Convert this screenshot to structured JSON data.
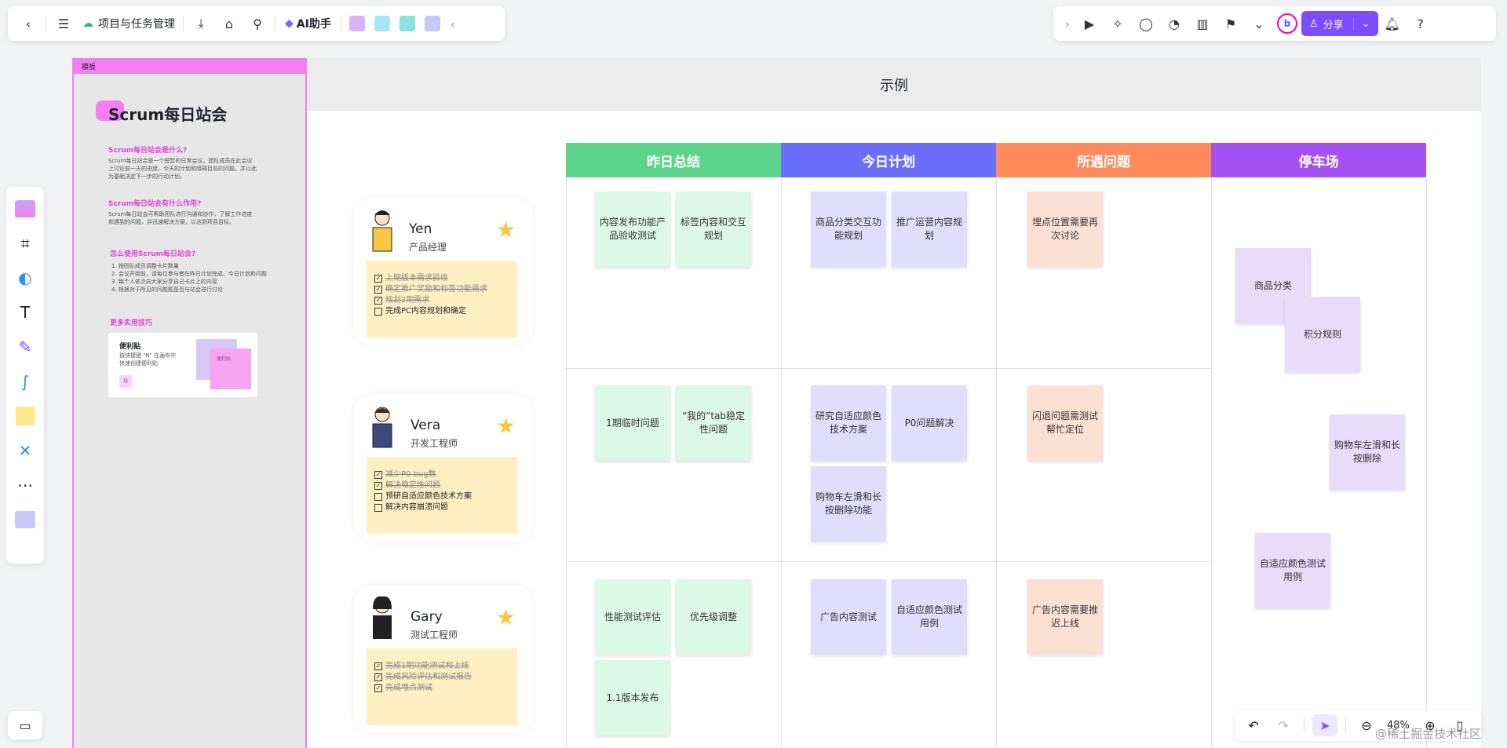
{
  "toolbar": {
    "doc_title": "项目与任务管理",
    "ai_label": "AI助手",
    "share_label": "分享"
  },
  "template": {
    "bar_label": "模板",
    "title": "Scrum每日站会",
    "q1": "Scrum每日站会是什么?",
    "a1": "Scrum每日站会是一个短暂的日常会议，团队成员在此会议上讨论前一天的进度、今天的计划和阻碍目前的问题，并以此为基础决定下一步的行动计划。",
    "q2": "Scrum每日站会有什么作用?",
    "a2": "Scrum每日站会可帮助团队进行沟通和协作，了解工作进度和遇到的问题，并迅速解决方案，以达到项目目标。",
    "q3": "怎么使用Scrum每日站会?",
    "steps": [
      "1. 按团队成员调整卡片数量",
      "2. 会议开始前，请每位参与者在昨日计划完成、今日计划和问题",
      "3. 每个人依次向大家分享自己卡片上的内容",
      "4. 根据对于所见的问题题是否与站会进行讨论"
    ],
    "q4": "更多实用技巧",
    "tip_title": "便利贴",
    "tip_text1": "按快捷键 \"N\" 在画布中",
    "tip_text2": "快速创建便利贴",
    "tip_key": "N",
    "tip_note": "便利贴"
  },
  "board": {
    "title": "示例",
    "columns": [
      {
        "label": "昨日总结",
        "color": "#5cd48b"
      },
      {
        "label": "今日计划",
        "color": "#6b6ef9"
      },
      {
        "label": "所遇问题",
        "color": "#ff8a5c"
      },
      {
        "label": "停车场",
        "color": "#a550f0"
      }
    ],
    "people": [
      {
        "name": "Yen",
        "role": "产品经理",
        "tasks": [
          {
            "text": "上期版本需求验收",
            "done": true
          },
          {
            "text": "确定推广奖励和标签功能需求",
            "done": true
          },
          {
            "text": "规划2期需求",
            "done": true
          },
          {
            "text": "完成PC内容规划和确定",
            "done": false
          }
        ]
      },
      {
        "name": "Vera",
        "role": "开发工程师",
        "tasks": [
          {
            "text": "减少P0 bug数",
            "done": true
          },
          {
            "text": "解决稳定性问题",
            "done": true
          },
          {
            "text": "预研自适应颜色技术方案",
            "done": false
          },
          {
            "text": "解决内容崩溃问题",
            "done": false
          }
        ]
      },
      {
        "name": "Gary",
        "role": "测试工程师",
        "tasks": [
          {
            "text": "完成1期功能测试和上线",
            "done": true
          },
          {
            "text": "完成风险评估和测试报告",
            "done": true
          },
          {
            "text": "完成埋点测试",
            "done": true
          }
        ]
      }
    ],
    "notes": {
      "yen_yesterday": [
        "内容发布功能产品验收测试",
        "标签内容和交互规划"
      ],
      "yen_today": [
        "商品分类交互功能规划",
        "推广运营内容规划"
      ],
      "yen_issue": [
        "埋点位置需要再次讨论"
      ],
      "vera_yesterday": [
        "1期临时问题",
        "“我的”tab稳定性问题"
      ],
      "vera_today": [
        "研究自适应颜色技术方案",
        "P0问题解决",
        "购物车左滑和长按删除功能"
      ],
      "vera_issue": [
        "闪退问题需测试帮忙定位"
      ],
      "gary_yesterday": [
        "性能测试评估",
        "优先级调整",
        "1.1版本发布"
      ],
      "gary_today": [
        "广告内容测试",
        "自适应颜色测试用例"
      ],
      "gary_issue": [
        "广告内容需要推迟上线"
      ],
      "parking": [
        "商品分类",
        "积分规则",
        "购物车左滑和长按删除",
        "自适应颜色测试用例"
      ]
    }
  },
  "bottom": {
    "zoom": "48%"
  },
  "watermark": "@稀土掘金技术社区"
}
